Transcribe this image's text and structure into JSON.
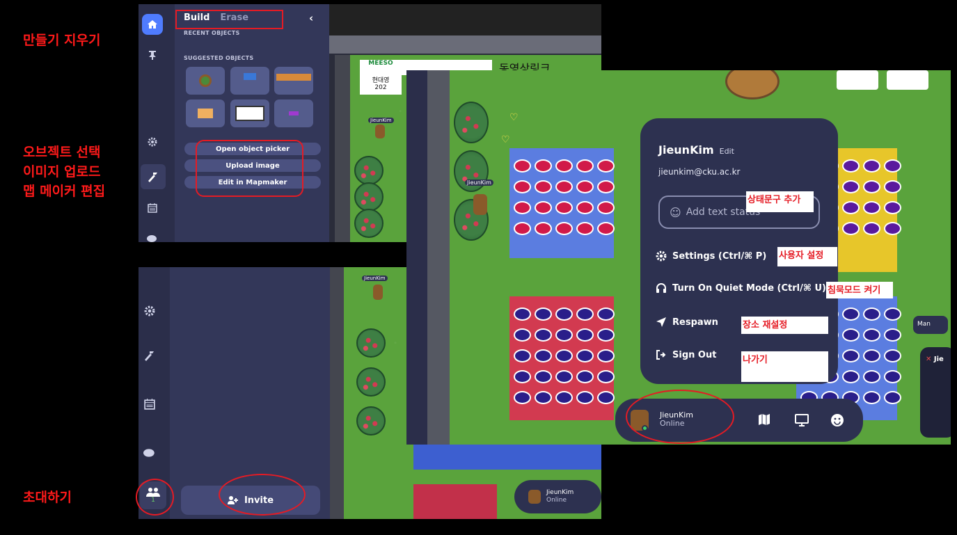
{
  "annotations": {
    "build_erase": "만들기 지우기",
    "object_select": "오브젝트 선택",
    "image_upload": "이미지 업로드",
    "map_maker_edit": "맵 메이커 편집",
    "invite": "초대하기",
    "status_text": "상태문구 추가",
    "user_settings": "사용자 설정",
    "quiet_mode": "침묵모드 켜기",
    "respawn": "장소 재설정",
    "leave": "나가기"
  },
  "build_panel": {
    "tab_build": "Build",
    "tab_erase": "Erase",
    "recent_objects": "RECENT OBJECTS",
    "suggested_objects": "SUGGESTED OBJECTS",
    "open_object_picker": "Open object picker",
    "upload_image": "Upload image",
    "edit_in_mapmaker": "Edit in Mapmaker"
  },
  "map": {
    "banner_logo": "MEESO",
    "banner_sub": "현대영",
    "banner_year": "202",
    "korean_sign": "동영상링크",
    "player_tag": "JieunKim"
  },
  "invite_panel": {
    "invite_label": "Invite",
    "members_count": "1"
  },
  "profile_menu": {
    "name": "JieunKim",
    "edit": "Edit",
    "email": "jieunkim@cku.ac.kr",
    "status_placeholder": "Add text status",
    "settings": "Settings (Ctrl/⌘ P)",
    "quiet_mode": "Turn On Quiet Mode (Ctrl/⌘ U)",
    "respawn": "Respawn",
    "sign_out": "Sign Out"
  },
  "bottom_bar": {
    "name": "JieunKim",
    "status": "Online"
  },
  "side_chips": {
    "man": "Man",
    "jie": "Jie"
  },
  "colors": {
    "rail": "#2b2e4a",
    "panel": "#333759",
    "accent": "#4f7cff",
    "annotation": "#ff1a1a",
    "grass": "#5aa33c"
  }
}
